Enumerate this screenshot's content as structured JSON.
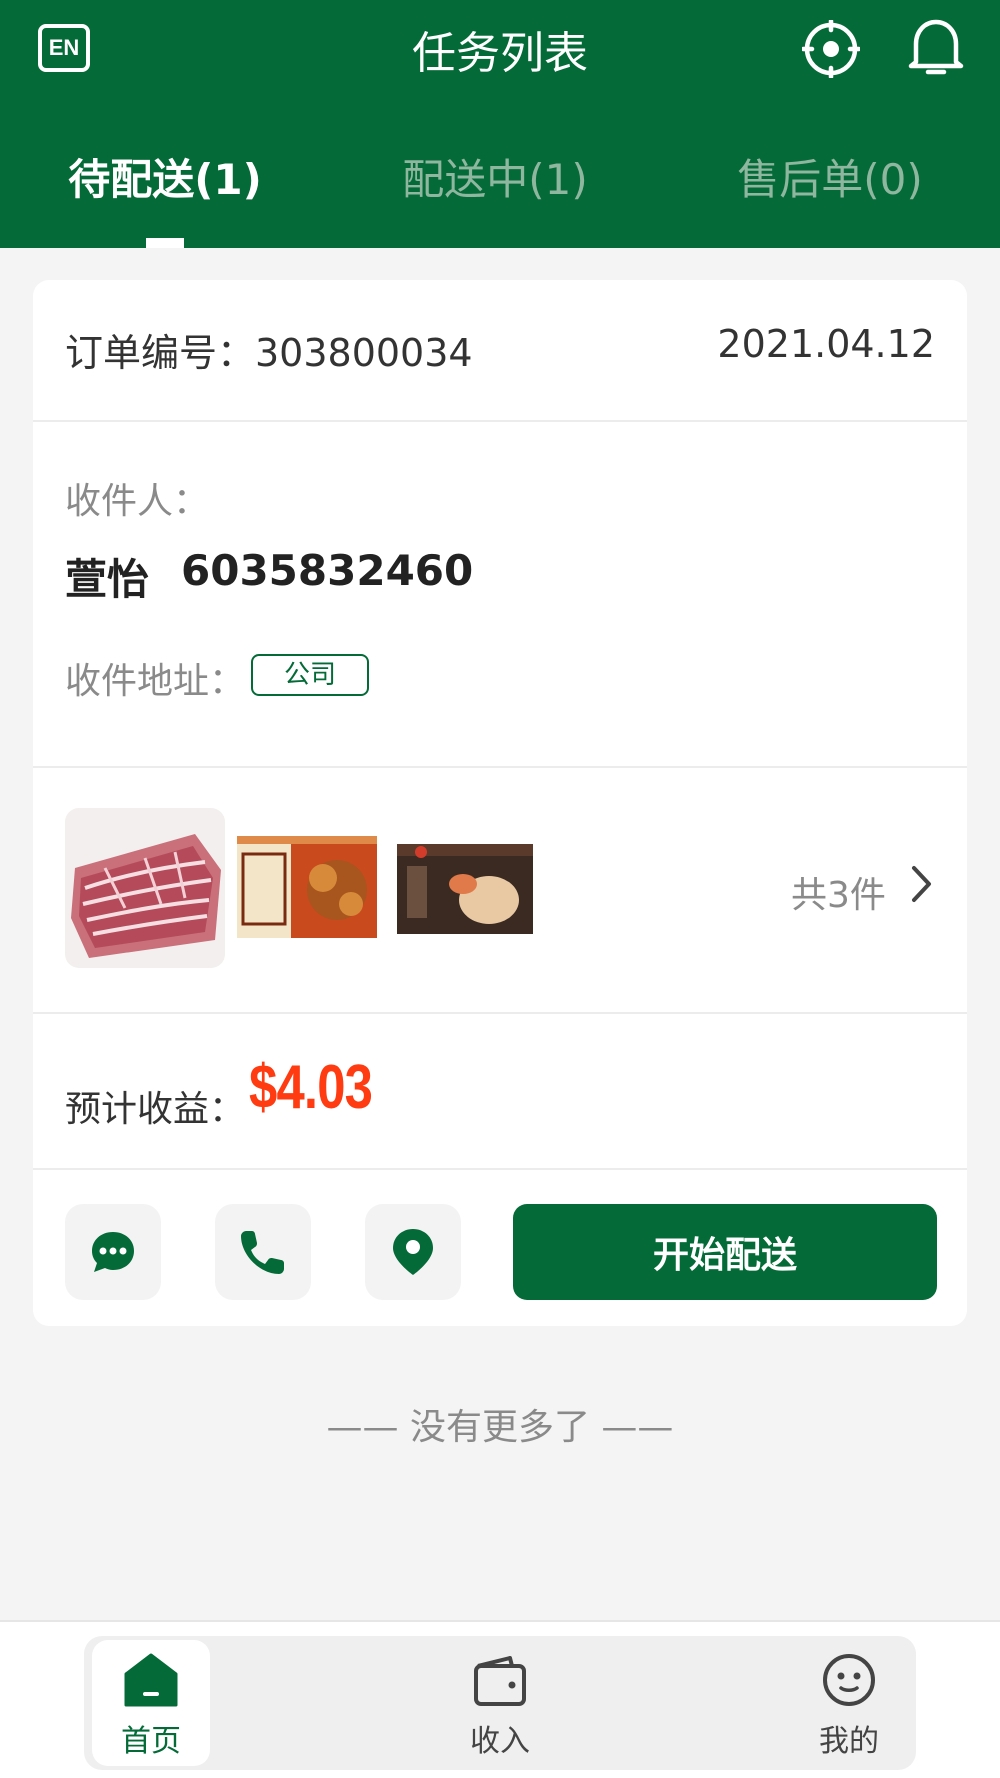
{
  "header": {
    "en_label": "EN",
    "title": "任务列表",
    "icons": [
      "locate-icon",
      "bell-icon"
    ]
  },
  "tabs": [
    {
      "label": "待配送(1)",
      "active": true
    },
    {
      "label": "配送中(1)",
      "active": false
    },
    {
      "label": "售后单(0)",
      "active": false
    }
  ],
  "order": {
    "number_label": "订单编号：303800034",
    "date": "2021.04.12",
    "recipient_label": "收件人：",
    "recipient_name": "萱怡",
    "recipient_phone": "6035832460",
    "address_label": "收件地址：",
    "address_tag": "公司",
    "item_count": "共3件",
    "profit_label": "预计收益：",
    "profit_value": "$4.03",
    "start_button": "开始配送"
  },
  "footer_text": "—— 没有更多了 ——",
  "bottom_nav": [
    {
      "label": "首页",
      "icon": "home-icon",
      "active": true
    },
    {
      "label": "收入",
      "icon": "wallet-icon",
      "active": false
    },
    {
      "label": "我的",
      "icon": "profile-icon",
      "active": false
    }
  ],
  "colors": {
    "brand": "#046b38",
    "profit": "#ff3b12",
    "background": "#f4f4f4"
  }
}
